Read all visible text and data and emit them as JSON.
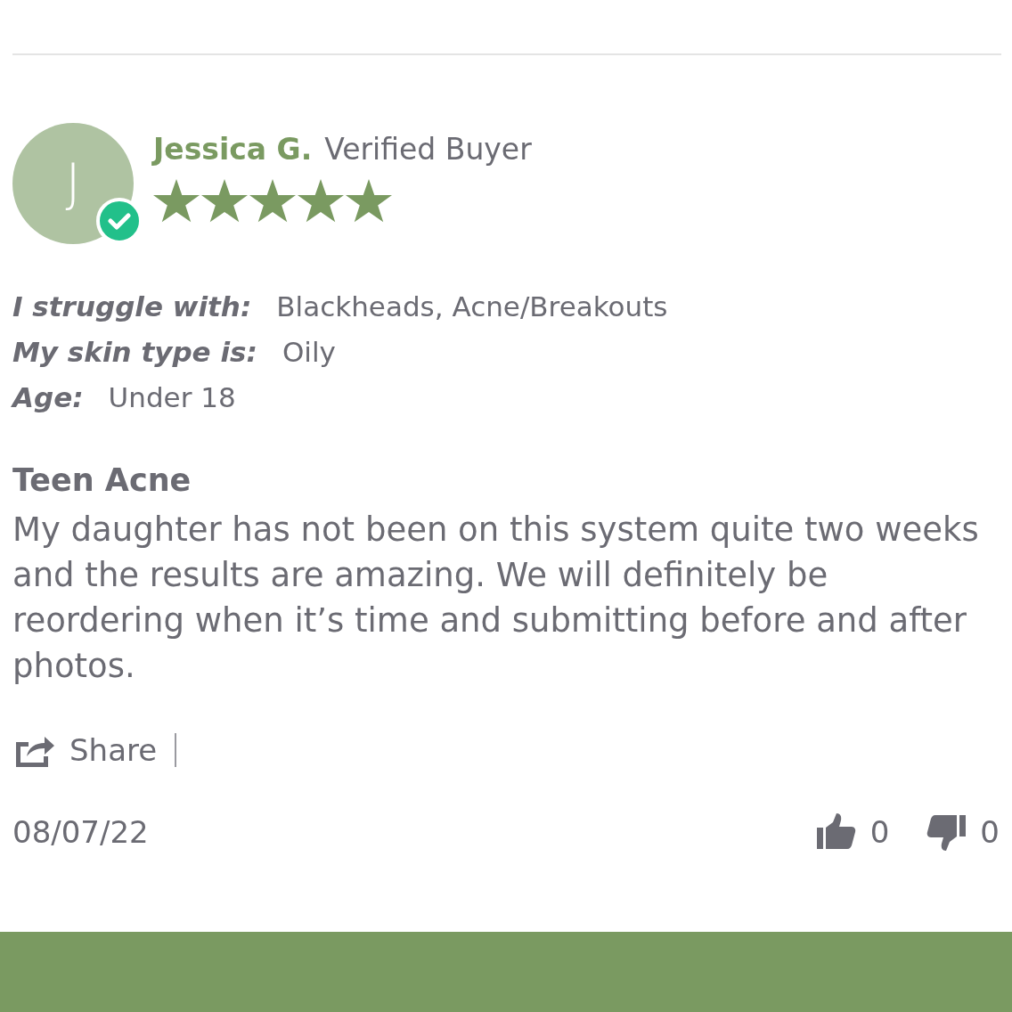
{
  "review": {
    "avatar_initial": "J",
    "verified": true,
    "author": "Jessica G.",
    "badge": "Verified Buyer",
    "stars": 5,
    "details": [
      {
        "label": "I struggle with:",
        "value": "Blackheads, Acne/Breakouts"
      },
      {
        "label": "My skin type is:",
        "value": "Oily"
      },
      {
        "label": "Age:",
        "value": "Under 18"
      }
    ],
    "title": "Teen Acne",
    "body": "My daughter has not been on this system quite two weeks and the results are amazing. We will definitely be reordering when it’s time and submitting before and after photos.",
    "share": "Share",
    "date": "08/07/22",
    "helpful_yes": "0",
    "helpful_no": "0"
  }
}
